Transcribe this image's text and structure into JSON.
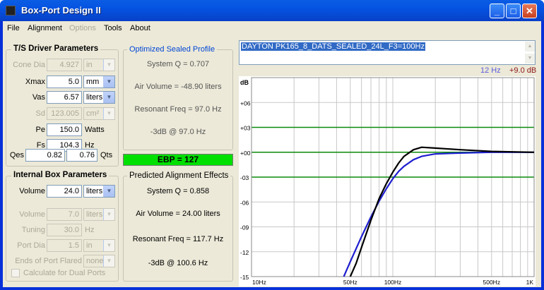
{
  "window": {
    "title": "Box-Port Design II"
  },
  "menu": [
    "File",
    "Alignment",
    "Options",
    "Tools",
    "About"
  ],
  "ts": {
    "title": "T/S Driver Parameters",
    "cone_dia": {
      "label": "Cone Dia",
      "value": "4.927",
      "unit": "in"
    },
    "xmax": {
      "label": "Xmax",
      "value": "5.0",
      "unit": "mm"
    },
    "vas": {
      "label": "Vas",
      "value": "6.57",
      "unit": "liters"
    },
    "sd": {
      "label": "Sd",
      "value": "123.005",
      "unit": "cm²"
    },
    "pe": {
      "label": "Pe",
      "value": "150.0",
      "unit": "Watts"
    },
    "fs": {
      "label": "Fs",
      "value": "104.3",
      "unit": "Hz"
    },
    "qes": {
      "label": "Qes",
      "value": "0.82"
    },
    "qts": {
      "label": "Qts",
      "value": "0.76"
    }
  },
  "opt": {
    "title": "Optimized Sealed Profile",
    "system_q": "System Q = 0.707",
    "air_volume": "Air Volume = -48.90 liters",
    "res_freq": "Resonant Freq = 97.0 Hz",
    "db3": "-3dB @ 97.0 Hz"
  },
  "ebp": "EBP = 127",
  "box": {
    "title": "Internal Box Parameters",
    "volume": {
      "label": "Volume",
      "value": "24.0",
      "unit": "liters"
    },
    "volume2": {
      "label": "Volume",
      "value": "7.0",
      "unit": "liters"
    },
    "tuning": {
      "label": "Tuning",
      "value": "30.0",
      "unit": "Hz"
    },
    "port_dia": {
      "label": "Port Dia",
      "value": "1.5",
      "unit": "in"
    },
    "ends": {
      "label": "Ends of Port Flared",
      "value": "none"
    },
    "dual": "Calculate for Dual Ports"
  },
  "pred": {
    "title": "Predicted Alignment Effects",
    "system_q": "System Q = 0.858",
    "air_volume": "Air Volume = 24.00 liters",
    "res_freq": "Resonant Freq = 117.7 Hz",
    "db3": "-3dB @ 100.6 Hz"
  },
  "profile": "DAYTON PK165_8_DATS_SEALED_24L_F3=100Hz",
  "legend": {
    "hz": "12 Hz",
    "db": "+9.0 dB"
  },
  "colors": {
    "optimized": "#1e1ed0",
    "predicted": "#000000",
    "ref": "#0a8a0a"
  },
  "chart_data": {
    "type": "line",
    "ylabel": "dB",
    "x_scale": "log",
    "xlim": [
      10,
      1000
    ],
    "ylim": [
      -15,
      9
    ],
    "yticks": [
      "+06",
      "+03",
      "+00",
      "-03",
      "-06",
      "-09",
      "-12",
      "-15"
    ],
    "xticks": [
      "10Hz",
      "50Hz",
      "100Hz",
      "500Hz",
      "1K"
    ],
    "reference_lines": [
      3,
      0,
      -3
    ],
    "series": [
      {
        "x": [
          45,
          50,
          60,
          70,
          80,
          90,
          100,
          110,
          120,
          140,
          160,
          200,
          300,
          500,
          1000
        ],
        "y": [
          -15,
          -13.2,
          -10.2,
          -7.8,
          -5.9,
          -4.4,
          -3.2,
          -2.3,
          -1.7,
          -0.9,
          -0.5,
          -0.2,
          -0.1,
          0,
          0
        ]
      },
      {
        "x": [
          50,
          55,
          60,
          70,
          80,
          90,
          100,
          110,
          120,
          140,
          160,
          200,
          300,
          500,
          1000
        ],
        "y": [
          -15,
          -13.4,
          -11.5,
          -8.2,
          -5.6,
          -3.8,
          -2.4,
          -1.3,
          -0.5,
          0.3,
          0.6,
          0.5,
          0.3,
          0.1,
          0
        ]
      }
    ]
  }
}
